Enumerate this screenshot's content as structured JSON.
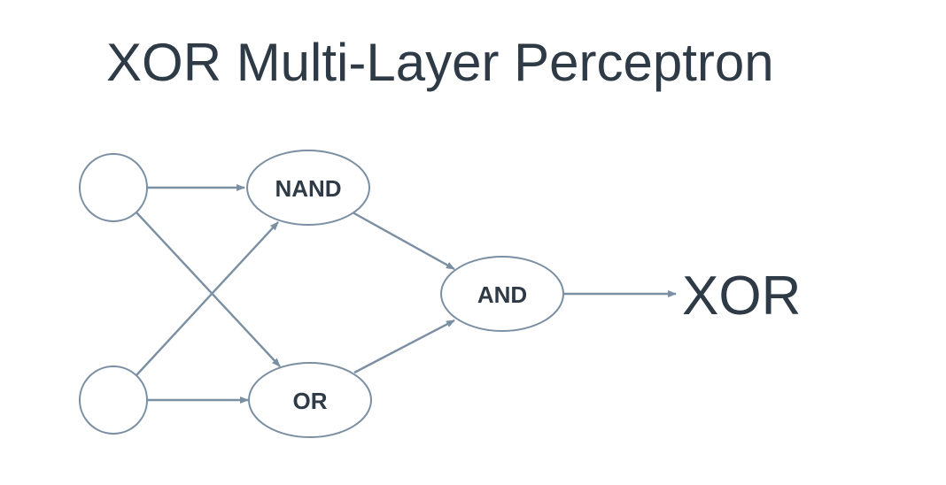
{
  "title": "XOR Multi-Layer Perceptron",
  "nodes": {
    "nand": "NAND",
    "or": "OR",
    "and": "AND"
  },
  "output": "XOR",
  "colors": {
    "text": "#2e3a45",
    "line": "#7a8fa2",
    "background": "#ffffff"
  }
}
